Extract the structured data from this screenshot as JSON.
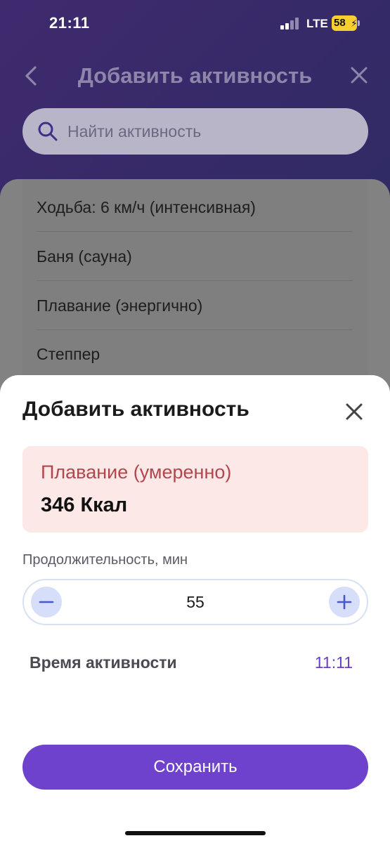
{
  "status_bar": {
    "time": "21:11",
    "network": "LTE",
    "battery": "58"
  },
  "nav": {
    "title": "Добавить активность",
    "back_icon": "chevron-left-icon",
    "close_icon": "close-icon"
  },
  "search": {
    "placeholder": "Найти активность",
    "icon": "search-icon"
  },
  "activity_list": [
    "Ходьба: 6 км/ч (интенсивная)",
    "Баня (сауна)",
    "Плавание (энергично)",
    "Степпер"
  ],
  "sheet": {
    "title": "Добавить активность",
    "activity": {
      "name": "Плавание (умеренно)",
      "kcal": "346 Ккал"
    },
    "duration": {
      "label": "Продолжительность, мин",
      "value": "55"
    },
    "activity_time": {
      "label": "Время активности",
      "value": "11:11"
    },
    "save_label": "Сохранить"
  },
  "colors": {
    "accent": "#6e42cc",
    "activity_card_bg": "#fde8e8",
    "activity_name": "#b2464d",
    "stepper_button": "#d6defa"
  }
}
